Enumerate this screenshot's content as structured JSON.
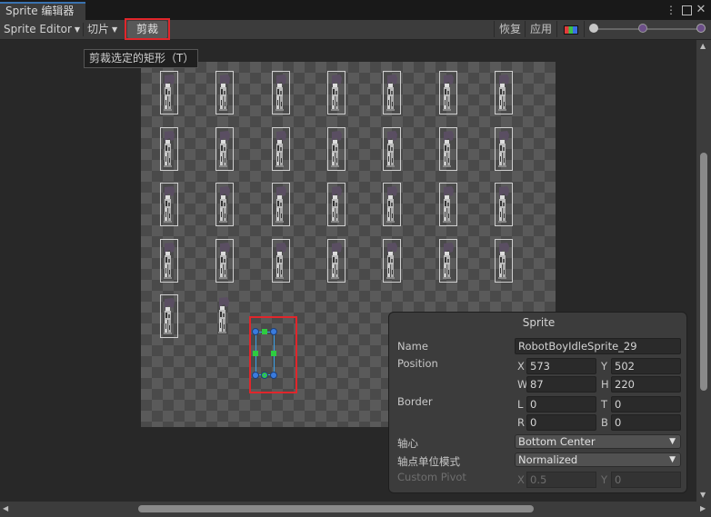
{
  "window": {
    "tab_title": "Sprite 编辑器",
    "menu_icon": "vertical-ellipsis-icon",
    "maximize_icon": "maximize-icon",
    "close_icon": "close-icon"
  },
  "toolbar": {
    "mode_dropdown": "Sprite Editor",
    "slice_dropdown": "切片",
    "trim_button": "剪裁",
    "revert_button": "恢复",
    "apply_button": "应用",
    "color_channel_icon": "rgb-channels-icon"
  },
  "tooltip": "剪裁选定的矩形（T）",
  "sprites": {
    "rows": [
      7,
      7,
      7,
      7,
      2
    ],
    "selected_index": 30,
    "robot_color": "#5a4e62"
  },
  "panel": {
    "title": "Sprite",
    "name_label": "Name",
    "name_value": "RobotBoyIdleSprite_29",
    "position_label": "Position",
    "x_label": "X",
    "x_value": "573",
    "y_label": "Y",
    "y_value": "502",
    "w_label": "W",
    "w_value": "87",
    "h_label": "H",
    "h_value": "220",
    "border_label": "Border",
    "l_label": "L",
    "l_value": "0",
    "t_label": "T",
    "t_value": "0",
    "r_label": "R",
    "r_value": "0",
    "b_label": "B",
    "b_value": "0",
    "pivot_label": "轴心",
    "pivot_value": "Bottom Center",
    "pivot_unit_label": "轴点单位模式",
    "pivot_unit_value": "Normalized",
    "custom_pivot_label": "Custom Pivot",
    "cx_label": "X",
    "cx_value": "0.5",
    "cy_label": "Y",
    "cy_value": "0"
  },
  "colors": {
    "highlight_red": "#e0262b",
    "selection_blue": "#3aa0e8",
    "handle_green": "#2ecc40"
  }
}
